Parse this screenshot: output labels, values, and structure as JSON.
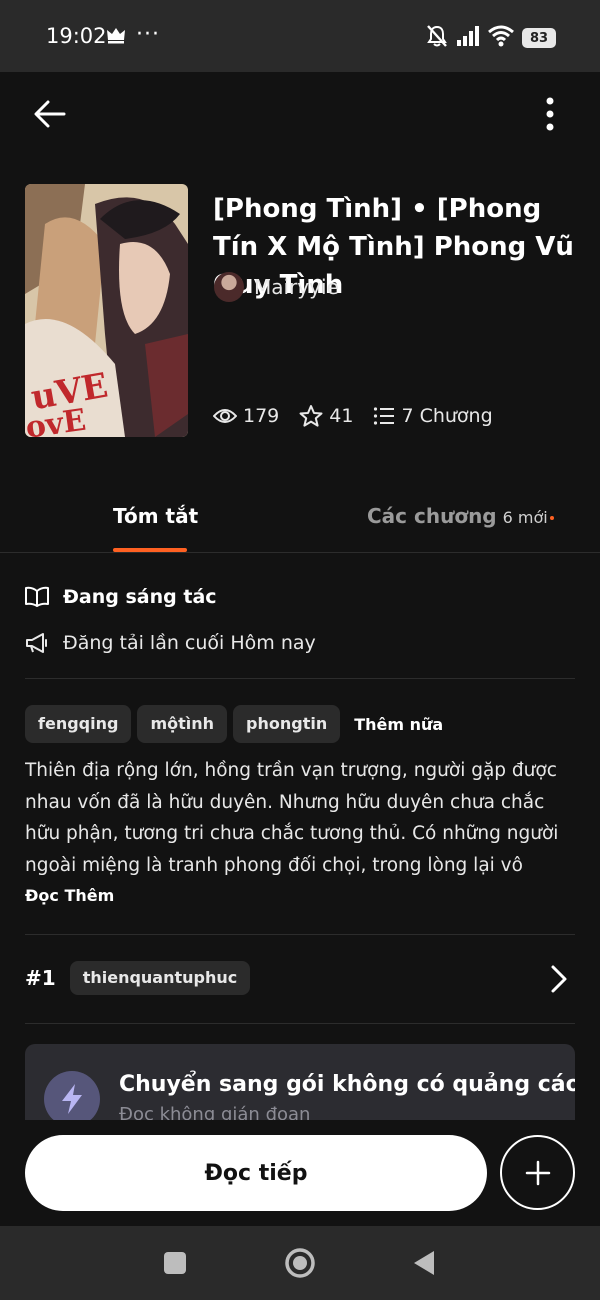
{
  "status_bar": {
    "time": "19:02",
    "dots": "···",
    "battery": "83"
  },
  "app_bar": {
    "back_icon": "arrow-left-icon",
    "more_icon": "more-vertical-icon"
  },
  "story": {
    "title": "[Phong Tình] • [Phong Tín X Mộ Tình] Phong Vũ Quy Tình",
    "author": "Mairyyie",
    "views": "179",
    "votes": "41",
    "chapters": "7 Chương"
  },
  "tabs": {
    "summary": "Tóm tắt",
    "chapters": "Các chương",
    "chapters_new": "6 mới"
  },
  "info": {
    "status": "Đang sáng tác",
    "last_update": "Đăng tải lần cuối Hôm nay"
  },
  "tags": [
    "fengqing",
    "mộtình",
    "phongtin"
  ],
  "tags_more": "Thêm nữa",
  "description": "Thiên địa rộng lớn, hồng trần vạn trượng, người gặp được nhau vốn đã là hữu duyên. Nhưng hữu duyên chưa chắc hữu phận, tương tri chưa chắc tương thủ. Có những người ngoài miệng là tranh phong đối chọi, trong lòng lại vô thanh vô t…",
  "read_more": "Đọc Thêm",
  "ranking": {
    "rank": "#1",
    "tag": "thienquantuphuc"
  },
  "promo": {
    "title": "Chuyển sang gói không có quảng cáo",
    "subtitle": "Đọc không gián đoạn"
  },
  "actions": {
    "read": "Đọc tiếp"
  },
  "colors": {
    "accent": "#ff6122",
    "background": "#121212",
    "chip": "#2b2b2b",
    "promo_bg": "#2c2c31",
    "promo_icon_bg": "#56567a"
  }
}
